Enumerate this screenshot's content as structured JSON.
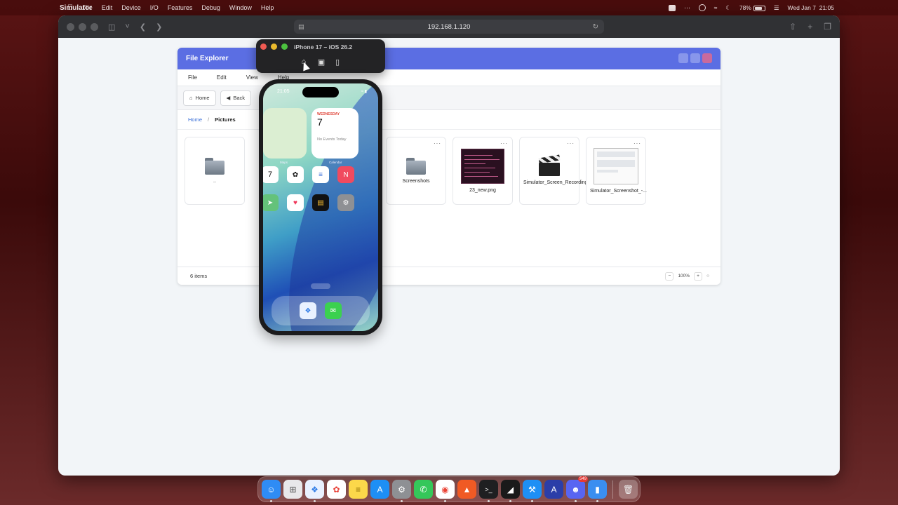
{
  "menubar": {
    "app_name": "Simulator",
    "items": [
      "File",
      "Edit",
      "Device",
      "I/O",
      "Features",
      "Debug",
      "Window",
      "Help"
    ],
    "battery": "78%",
    "battery_level": 0.78,
    "date": "Wed Jan 7",
    "time": "21:05"
  },
  "browser": {
    "url": "192.168.1.120"
  },
  "file_explorer": {
    "title": "File Explorer",
    "menu": [
      "File",
      "Edit",
      "View",
      "Help"
    ],
    "nav": {
      "home_label": "Home",
      "back_label": "Back"
    },
    "breadcrumb": {
      "home": "Home",
      "separator": "/",
      "current": "Pictures"
    },
    "items": [
      {
        "name": "..",
        "kind": "folder",
        "more": ""
      },
      {
        "name": "Screenshots",
        "kind": "folder",
        "more": "···"
      },
      {
        "name": "23_new.png",
        "kind": "image-terminal",
        "more": "···"
      },
      {
        "name": "Simulator_Screen_Recording_-...",
        "kind": "video",
        "more": "···"
      },
      {
        "name": "Simulator_Screenshot_-...",
        "kind": "image-screenshot",
        "more": "···"
      }
    ],
    "status": {
      "count": "6 items",
      "zoom_minus": "−",
      "zoom": "100%",
      "zoom_plus": "+",
      "zoom_reset": "○"
    }
  },
  "simulator": {
    "window_title": "iPhone 17 – iOS 26.2",
    "controls": [
      "home-icon",
      "screenshot-icon",
      "rotate-icon"
    ],
    "phone": {
      "time": "21:05",
      "calendar_widget": {
        "weekday": "WEDNESDAY",
        "date": "7",
        "events": "No Events Today"
      },
      "widget_labels": {
        "left": "Maps",
        "right": "Calendar"
      },
      "home_apps": [
        "Calendar",
        "Photos",
        "Reminders",
        "News",
        "Maps",
        "Health",
        "Wallet",
        "Settings"
      ],
      "dock_apps": [
        "Safari",
        "Messages"
      ]
    }
  },
  "dock": {
    "apps": [
      "Finder",
      "Launchpad",
      "Safari",
      "Photos",
      "Notes",
      "App Store",
      "System Settings",
      "WhatsApp",
      "Chrome",
      "Brave",
      "Terminal",
      "Cursor",
      "Xcode",
      "Arc",
      "Discord",
      "Simulator",
      "Trash"
    ],
    "discord_badge": "549"
  },
  "colors": {
    "accent": "#5b6ee3",
    "link": "#3a6fd8"
  }
}
